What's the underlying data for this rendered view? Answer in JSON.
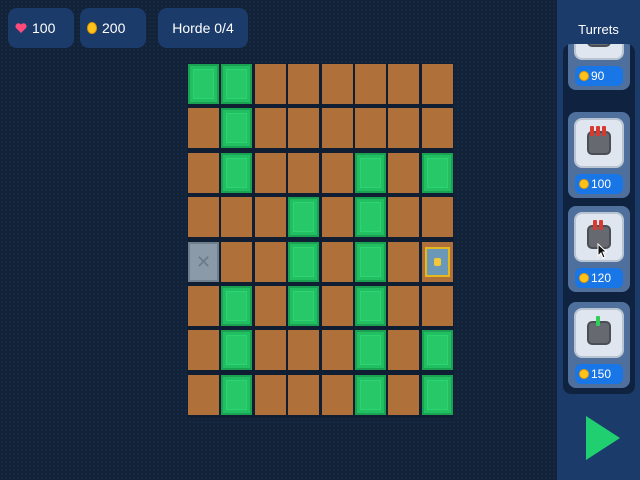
{
  "hud": {
    "health": "100",
    "coins": "200",
    "horde": "Horde 0/4"
  },
  "sidebar": {
    "title": "Turrets",
    "turrets": [
      {
        "price": "90",
        "barrels": 1,
        "barrel_color": "#d93a2f"
      },
      {
        "price": "100",
        "barrels": 3,
        "barrel_color": "#d93a2f"
      },
      {
        "price": "120",
        "barrels": 2,
        "barrel_color": "#d93a2f"
      },
      {
        "price": "150",
        "barrels": 1,
        "barrel_color": "#2fcf5a"
      }
    ]
  },
  "colors": {
    "dirt": "#b0703a",
    "grass": "#21bf62",
    "panel": "#1b3c6b",
    "background": "#122238",
    "play": "#20d070"
  },
  "map": {
    "columns": 8,
    "rows": 8,
    "tiles": [
      "GGDDDDDD",
      "DGDDDDDD",
      "DGDDDGDG",
      "DDDGDGDD",
      "SDDGDGDE",
      "DGDGDGDD",
      "DGDDDGDG",
      "DGDDDGDG"
    ],
    "legend": {
      "G": "grass",
      "D": "dirt",
      "S": "spawn",
      "E": "goal"
    }
  }
}
